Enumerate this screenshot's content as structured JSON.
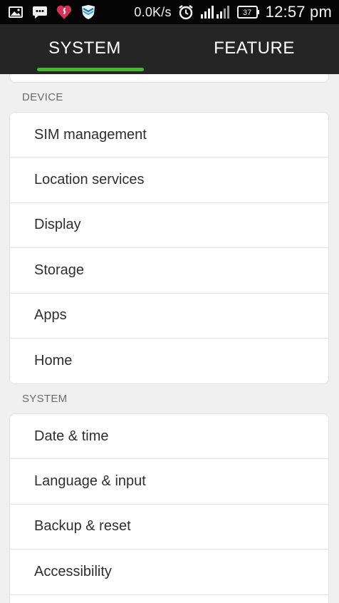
{
  "status_bar": {
    "speed": "0.0K/s",
    "battery": "37",
    "time": "12:57",
    "time_suffix": "pm",
    "icons": [
      "image-icon",
      "chat-icon",
      "heart-icon",
      "shield-icon",
      "alarm-icon",
      "signal-icon",
      "battery-icon"
    ]
  },
  "tabs": [
    {
      "label": "SYSTEM",
      "selected": true
    },
    {
      "label": "FEATURE",
      "selected": false
    }
  ],
  "accent_color": "#38c21e",
  "sections": [
    {
      "header": "DEVICE",
      "items": [
        {
          "label": "SIM management"
        },
        {
          "label": "Location services"
        },
        {
          "label": "Display"
        },
        {
          "label": "Storage"
        },
        {
          "label": "Apps"
        },
        {
          "label": "Home"
        }
      ]
    },
    {
      "header": "SYSTEM",
      "items": [
        {
          "label": "Date & time"
        },
        {
          "label": "Language & input"
        },
        {
          "label": "Backup & reset"
        },
        {
          "label": "Accessibility"
        }
      ]
    }
  ]
}
